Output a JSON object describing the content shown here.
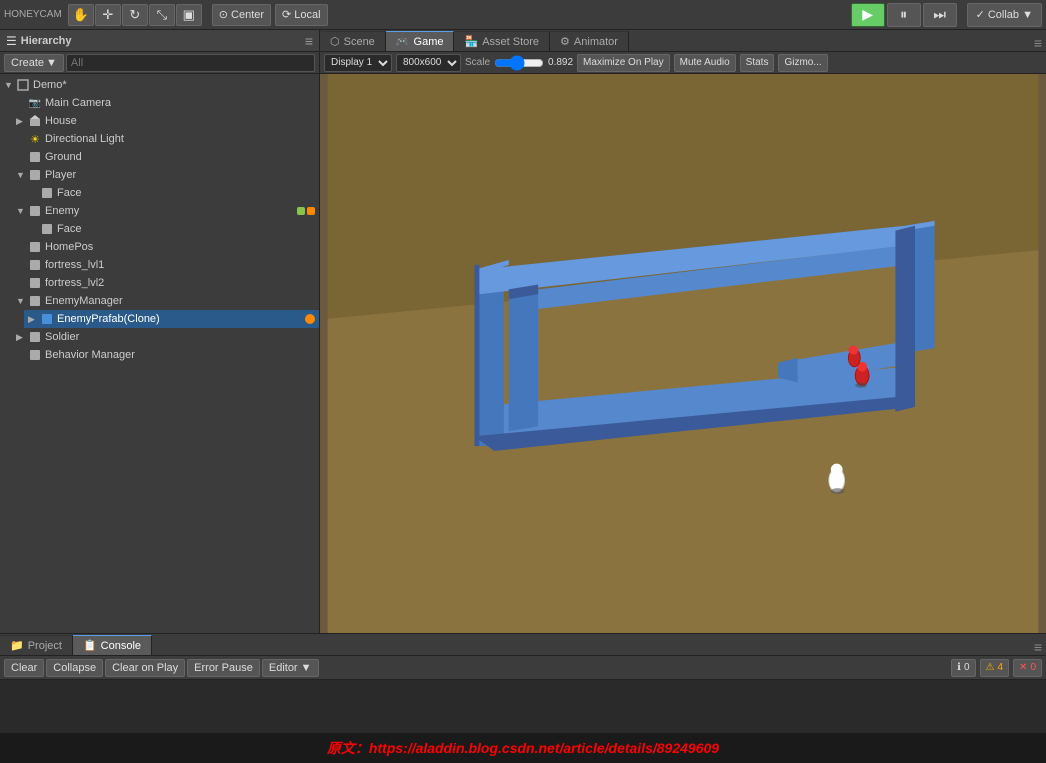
{
  "app": {
    "title": "HONEYCAM",
    "watermark": "原文：https://aladdin.blog.csdn.net/article/details/89249609"
  },
  "toolbar": {
    "transform_tools": [
      "hand",
      "move",
      "rotate",
      "scale",
      "rect"
    ],
    "pivot_center": "Center",
    "pivot_local": "Local",
    "play_label": "▶",
    "pause_label": "⏸",
    "step_label": "⏭",
    "collab_label": "Collab ▼"
  },
  "hierarchy": {
    "panel_title": "Hierarchy",
    "create_label": "Create",
    "search_placeholder": "All",
    "scene_name": "Demo*",
    "items": [
      {
        "id": "main-camera",
        "label": "Main Camera",
        "indent": 1,
        "type": "camera",
        "arrow": "",
        "selected": false
      },
      {
        "id": "house",
        "label": "House",
        "indent": 1,
        "type": "object",
        "arrow": "▶",
        "selected": false
      },
      {
        "id": "directional-light",
        "label": "Directional Light",
        "indent": 1,
        "type": "light",
        "arrow": "",
        "selected": false
      },
      {
        "id": "ground",
        "label": "Ground",
        "indent": 1,
        "type": "object",
        "arrow": "",
        "selected": false
      },
      {
        "id": "player",
        "label": "Player",
        "indent": 1,
        "type": "object",
        "arrow": "▼",
        "selected": false
      },
      {
        "id": "face",
        "label": "Face",
        "indent": 2,
        "type": "object",
        "arrow": "",
        "selected": false
      },
      {
        "id": "enemy",
        "label": "Enemy",
        "indent": 1,
        "type": "object",
        "arrow": "▼",
        "selected": false
      },
      {
        "id": "face2",
        "label": "Face",
        "indent": 2,
        "type": "object",
        "arrow": "",
        "selected": false
      },
      {
        "id": "homepos",
        "label": "HomePos",
        "indent": 1,
        "type": "object",
        "arrow": "",
        "selected": false
      },
      {
        "id": "fortress-lvl1",
        "label": "fortress_lvl1",
        "indent": 1,
        "type": "object",
        "arrow": "",
        "selected": false
      },
      {
        "id": "fortress-lvl2",
        "label": "fortress_lvl2",
        "indent": 1,
        "type": "object",
        "arrow": "",
        "selected": false
      },
      {
        "id": "enemy-manager",
        "label": "EnemyManager",
        "indent": 1,
        "type": "object",
        "arrow": "▼",
        "selected": false
      },
      {
        "id": "enemy-prefab-clone",
        "label": "EnemyPrafab(Clone)",
        "indent": 2,
        "type": "object",
        "arrow": "▶",
        "selected": true,
        "dot": "orange"
      },
      {
        "id": "soldier",
        "label": "Soldier",
        "indent": 1,
        "type": "object",
        "arrow": "▶",
        "selected": false
      },
      {
        "id": "behavior-manager",
        "label": "Behavior Manager",
        "indent": 1,
        "type": "object",
        "arrow": "",
        "selected": false
      }
    ]
  },
  "tabs": {
    "scene": {
      "label": "Scene",
      "icon": "⬡"
    },
    "game": {
      "label": "Game",
      "icon": "🎮",
      "active": true
    },
    "asset_store": {
      "label": "Asset Store",
      "icon": "🏪"
    },
    "animator": {
      "label": "Animator",
      "icon": "⚙"
    }
  },
  "game_toolbar": {
    "display": "Display 1",
    "resolution": "800x600",
    "scale_label": "Scale",
    "scale_value": "0.892",
    "maximize_on_play": "Maximize On Play",
    "mute_audio": "Mute Audio",
    "stats": "Stats",
    "gizmos": "Gizmo..."
  },
  "bottom": {
    "project_tab": "Project",
    "console_tab": "Console",
    "clear": "Clear",
    "collapse": "Collapse",
    "clear_on_play": "Clear on Play",
    "error_pause": "Error Pause",
    "editor_dropdown": "Editor",
    "info_count": "0",
    "warn_count": "4",
    "error_count": "0"
  }
}
